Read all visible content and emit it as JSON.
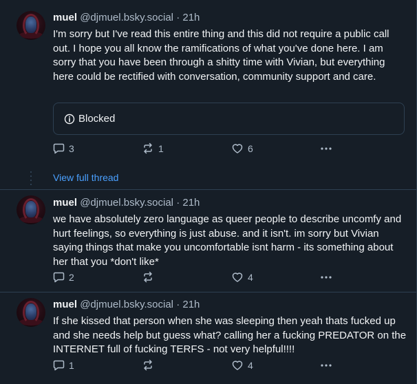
{
  "posts": [
    {
      "author_name": "muel",
      "author_handle": "@djmuel.bsky.social",
      "separator": "·",
      "time": "21h",
      "text": "I'm sorry but I've read this entire thing and this did not require a public call out. I hope you all know the ramifications of what you've done here. I am sorry that you have been through a shitty time with Vivian, but everything here could be rectified with conversation, community support and care.",
      "embed_label": "Blocked",
      "replies": "3",
      "reposts": "1",
      "likes": "6"
    },
    {
      "author_name": "muel",
      "author_handle": "@djmuel.bsky.social",
      "separator": "·",
      "time": "21h",
      "text": "we have absolutely zero language as queer people to describe uncomfy and hurt feelings, so everything is just abuse. and it isn't. im sorry but Vivian saying things that make you uncomfortable isnt harm - its something about her that you *don't like*",
      "replies": "2",
      "reposts": "",
      "likes": "4"
    },
    {
      "author_name": "muel",
      "author_handle": "@djmuel.bsky.social",
      "separator": "·",
      "time": "21h",
      "text": "If she kissed that person when she was sleeping then yeah thats fucked up and she needs help but guess what? calling her a fucking PREDATOR on the INTERNET full of fucking TERFS - not very helpful!!!!",
      "replies": "1",
      "reposts": "",
      "likes": "4"
    }
  ],
  "view_full_thread": "View full thread",
  "colors": {
    "background": "#161e27",
    "border": "#2e4052",
    "text": "#f1f3f5",
    "muted": "#aebbc9",
    "link": "#4aa0ff"
  },
  "icons": {
    "reply": "speech-bubble-icon",
    "repost": "repost-arrows-icon",
    "like": "heart-icon",
    "more": "ellipsis-icon",
    "info": "info-circle-icon"
  }
}
